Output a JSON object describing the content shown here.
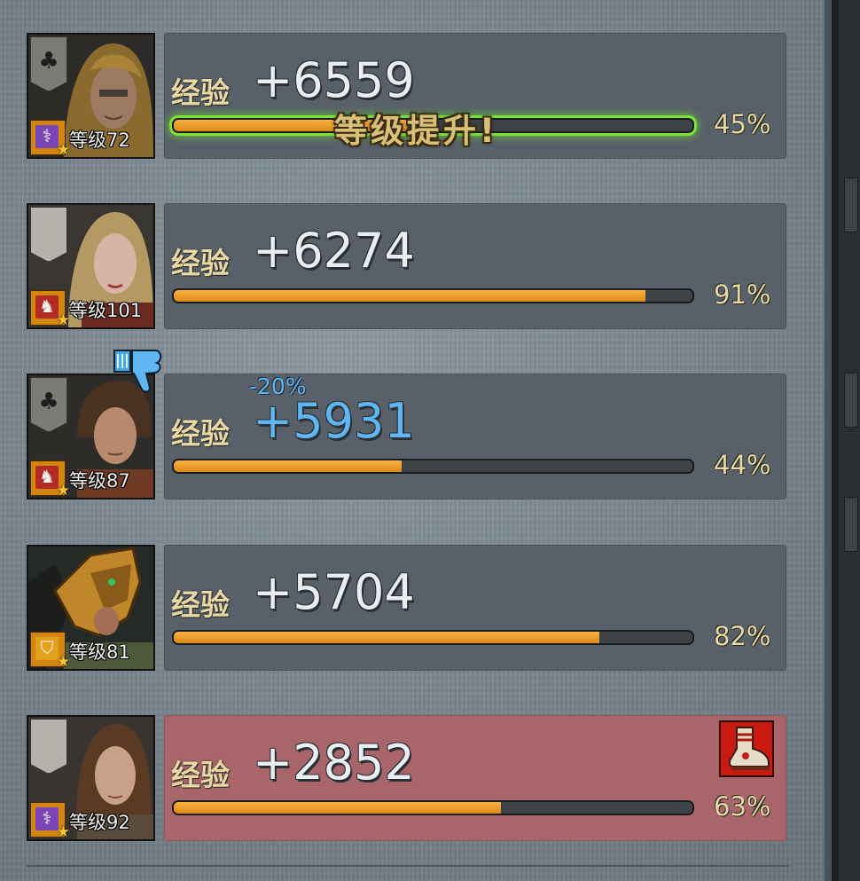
{
  "exp_label": "经验",
  "level_up_text": "等级提升!",
  "characters": [
    {
      "level_text": "等级72",
      "exp_gain": "+6559",
      "exp_modifier": "",
      "progress_text": "45%",
      "progress": 0.45,
      "leveled_up": true,
      "class_color": "purple",
      "class_icon": "staff-icon",
      "banner_icon": "tree-emblem-icon"
    },
    {
      "level_text": "等级101",
      "exp_gain": "+6274",
      "exp_modifier": "",
      "progress_text": "91%",
      "progress": 0.91,
      "leveled_up": false,
      "class_color": "red",
      "class_icon": "horse-head-icon",
      "banner_icon": "blank-banner-icon"
    },
    {
      "level_text": "等级87",
      "exp_gain": "+5931",
      "exp_modifier": "-20%",
      "progress_text": "44%",
      "progress": 0.44,
      "leveled_up": false,
      "class_color": "red",
      "class_icon": "horse-head-icon",
      "banner_icon": "tree-emblem-icon",
      "status_icon": "thumbs-down-icon"
    },
    {
      "level_text": "等级81",
      "exp_gain": "+5704",
      "exp_modifier": "",
      "progress_text": "82%",
      "progress": 0.82,
      "leveled_up": false,
      "class_color": "orange",
      "class_icon": "shield-icon",
      "banner_icon": ""
    },
    {
      "level_text": "等级92",
      "exp_gain": "+2852",
      "exp_modifier": "",
      "progress_text": "63%",
      "progress": 0.63,
      "leveled_up": false,
      "class_color": "purple",
      "class_icon": "staff-icon",
      "banner_icon": "blank-banner-icon",
      "highlighted": true,
      "item_icon": "boots-icon"
    }
  ],
  "colors": {
    "bar_fill": "#e89a22",
    "bar_empty": "#3d4347",
    "panel": "#58616a",
    "panel_highlight": "#a8666a",
    "exp_label": "#e8d8a6",
    "exp_value": "#eaeef2",
    "exp_value_reduced": "#5fb6f0",
    "level_up_glow": "#7ee03a"
  }
}
